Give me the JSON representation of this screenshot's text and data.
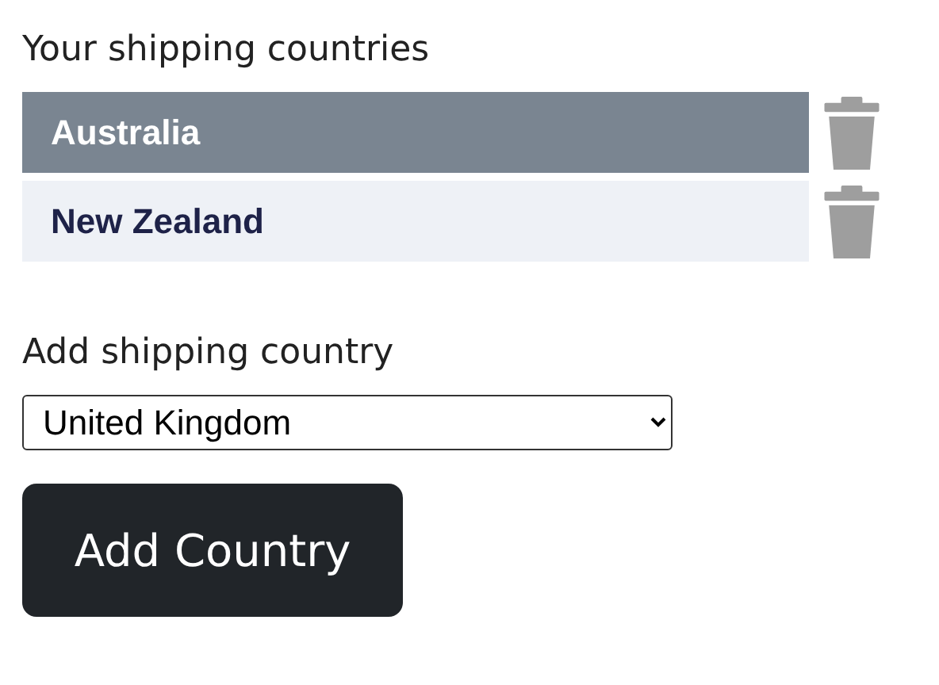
{
  "heading": "Your shipping countries",
  "countries": [
    {
      "name": "Australia",
      "selected": true
    },
    {
      "name": "New Zealand",
      "selected": false
    }
  ],
  "add": {
    "label": "Add shipping country",
    "value": "United Kingdom"
  },
  "button": "Add Country"
}
